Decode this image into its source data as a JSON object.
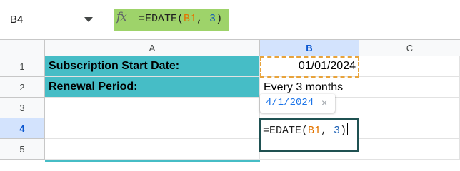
{
  "formula_bar": {
    "name_box": "B4",
    "fx": "fx",
    "formula_prefix": "=EDATE(",
    "formula_ref": "B1",
    "formula_sep": ", ",
    "formula_num": "3",
    "formula_suffix": ")",
    "highlight_color": "#9ed36a"
  },
  "columns": [
    {
      "label": "A",
      "selected": false
    },
    {
      "label": "B",
      "selected": true
    },
    {
      "label": "C",
      "selected": false
    }
  ],
  "rows": [
    {
      "label": "1",
      "selected": false
    },
    {
      "label": "2",
      "selected": false
    },
    {
      "label": "3",
      "selected": false
    },
    {
      "label": "4",
      "selected": true
    },
    {
      "label": "5",
      "selected": false
    }
  ],
  "cells": {
    "A1": "Subscription Start Date:",
    "B1": "01/01/2024",
    "A2": "Renewal Period:",
    "B2": "Every 3 months"
  },
  "tooltip": {
    "preview": "4/1/2024",
    "close": "×"
  },
  "editor": {
    "prefix": "=EDATE(",
    "ref": "B1",
    "sep": ", ",
    "num": "3",
    "suffix": ")"
  },
  "colors": {
    "teal_fill": "#46bdc6",
    "ref_orange": "#e37400",
    "selection_blue": "#d3e3fd",
    "editor_border": "#1f5152"
  }
}
